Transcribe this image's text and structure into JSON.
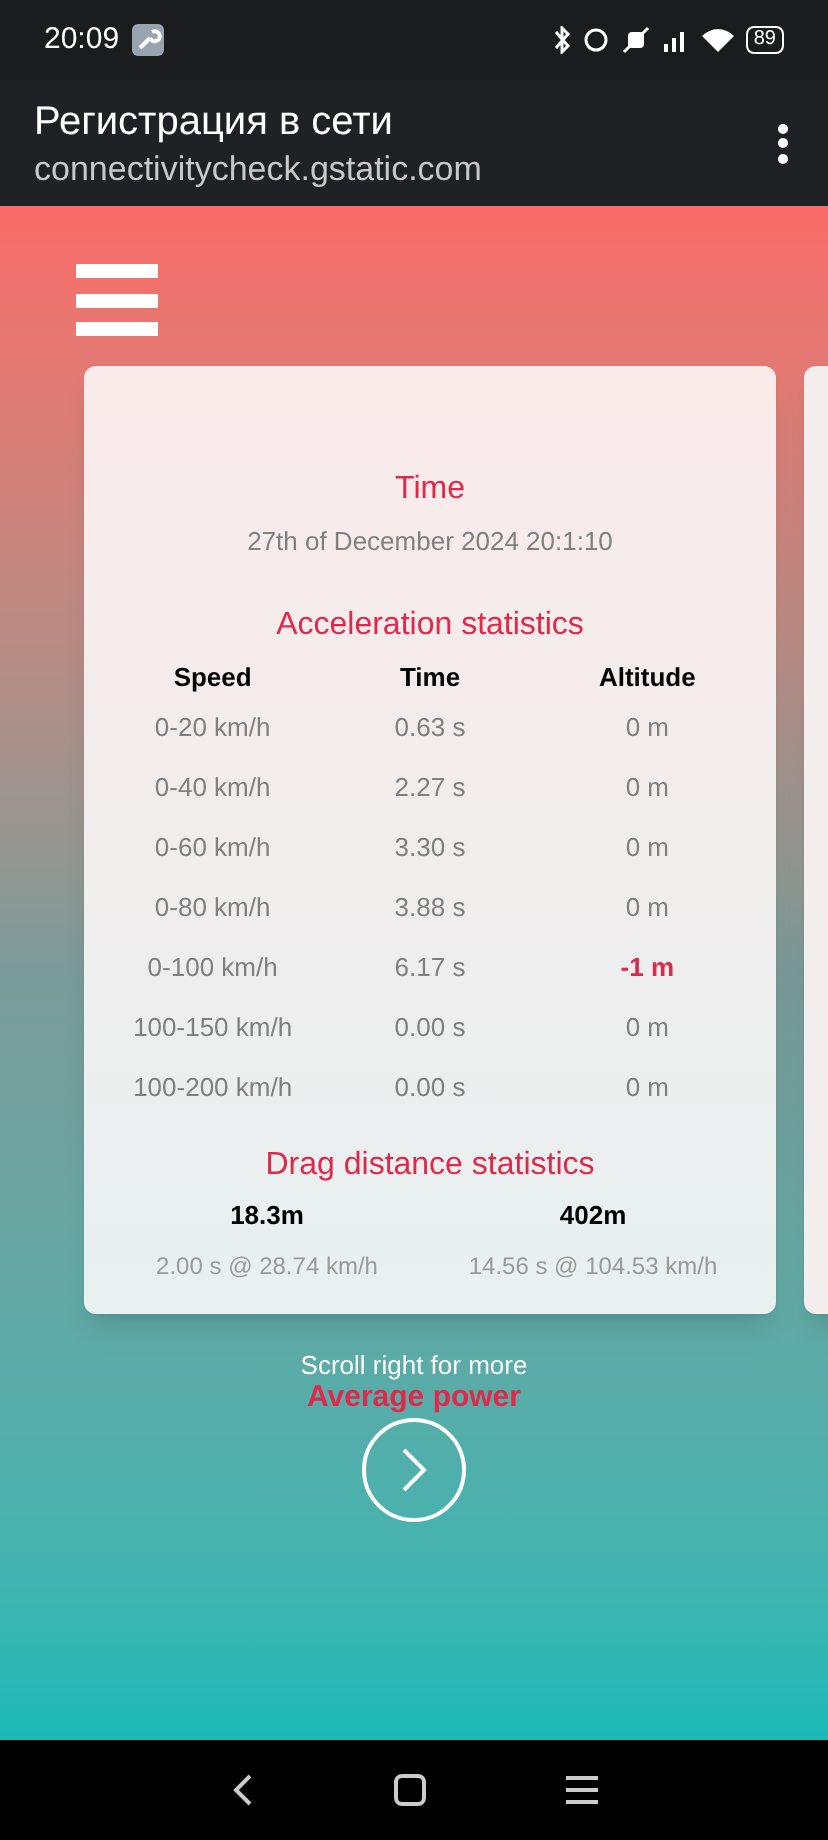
{
  "status_bar": {
    "time": "20:09",
    "battery": "89"
  },
  "header": {
    "title": "Регистрация в сети",
    "url": "connectivitycheck.gstatic.com"
  },
  "card": {
    "time_title": "Time",
    "time_value": "27th of December 2024 20:1:10",
    "accel_title": "Acceleration statistics",
    "columns": [
      "Speed",
      "Time",
      "Altitude"
    ],
    "rows": [
      {
        "speed": "0-20 km/h",
        "time": "0.63 s",
        "altitude": "0 m",
        "negative": false
      },
      {
        "speed": "0-40 km/h",
        "time": "2.27 s",
        "altitude": "0 m",
        "negative": false
      },
      {
        "speed": "0-60 km/h",
        "time": "3.30 s",
        "altitude": "0 m",
        "negative": false
      },
      {
        "speed": "0-80 km/h",
        "time": "3.88 s",
        "altitude": "0 m",
        "negative": false
      },
      {
        "speed": "0-100 km/h",
        "time": "6.17 s",
        "altitude": "-1 m",
        "negative": true
      },
      {
        "speed": "100-150 km/h",
        "time": "0.00 s",
        "altitude": "0 m",
        "negative": false
      },
      {
        "speed": "100-200 km/h",
        "time": "0.00 s",
        "altitude": "0 m",
        "negative": false
      }
    ],
    "drag_title": "Drag distance statistics",
    "drag": [
      {
        "distance": "18.3m",
        "result": "2.00 s @ 28.74 km/h"
      },
      {
        "distance": "402m",
        "result": "14.56 s @ 104.53 km/h"
      }
    ]
  },
  "scroll_hint": "Scroll right for more",
  "next_title": "Average power"
}
